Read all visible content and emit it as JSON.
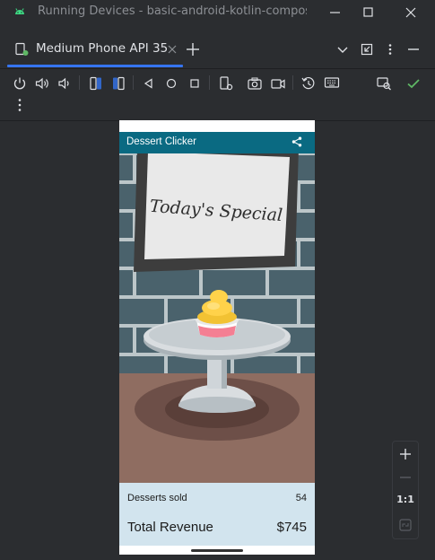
{
  "window": {
    "title": "Running Devices - basic-android-kotlin-compose"
  },
  "tabs": [
    {
      "label": "Medium Phone API 35"
    }
  ],
  "app": {
    "title": "Dessert Clicker",
    "sign_text": "Today's Special",
    "desserts_sold_label": "Desserts sold",
    "desserts_sold_value": "54",
    "total_revenue_label": "Total Revenue",
    "total_revenue_value": "$745"
  },
  "zoom": {
    "one_to_one_label": "1:1"
  },
  "colors": {
    "accent": "#3574f0",
    "app_bar": "#0a6a82",
    "stats_background": "#d2e4ee",
    "check": "#5fb865",
    "android_green": "#3ddc84"
  }
}
